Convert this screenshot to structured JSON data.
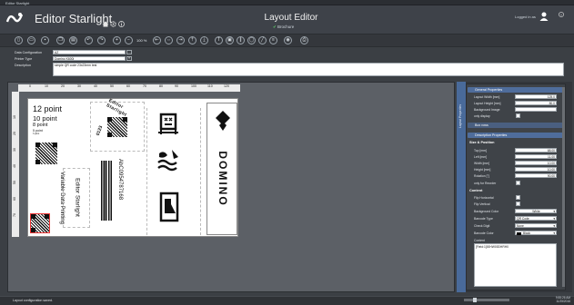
{
  "window": {
    "title": "Editor Starlight"
  },
  "header": {
    "app_name": "Editor Starlight",
    "layout_title": "Layout Editor",
    "layout_subtitle": "Brochure",
    "logged_in": "Logged in as"
  },
  "toolbar": {
    "zoom": "100 %"
  },
  "form": {
    "data_config_label": "Data Configuration",
    "data_config_value": "AZ",
    "printer_type_label": "Printer Type",
    "printer_type_value": "Domino K600i",
    "description_label": "Description",
    "description_value": "simple QR code 23x23mm test"
  },
  "ruler": {
    "top": [
      "0",
      "10",
      "20",
      "30",
      "40",
      "50",
      "60",
      "70",
      "80",
      "90",
      "100",
      "110",
      "120"
    ],
    "left": [
      "10",
      "20",
      "30",
      "40",
      "50",
      "60",
      "70"
    ]
  },
  "canvas": {
    "t12": "12 point",
    "t10": "10 point",
    "t8": "8 point",
    "t5": "5 point",
    "t3": "3 point",
    "arc_top": "Editor Starlight",
    "arc_bottom": "0123",
    "var_line1": "Editor Starlight",
    "var_line2": "Variable Data Printing",
    "barcode_text": "AbC0954787168",
    "brand": "DOMINO"
  },
  "panel": {
    "side_tab": "Layout Properties",
    "general_header": "General Properties",
    "layout_width_label": "Layout Width [mm]",
    "layout_width_value": "125.0",
    "layout_height_label": "Layout Height [mm]",
    "layout_height_value": "80.0",
    "bg_image_label": "Background Image",
    "only_display_label": "only display",
    "box_rows_header": "Box rows",
    "desc_header": "Description Properties",
    "size_pos_header": "Size & Position",
    "top_label": "Top [mm]",
    "top_value": "68.00",
    "left_label": "Left [mm]",
    "left_value": "11.00",
    "width_label": "Width [mm]",
    "width_value": "10.00",
    "height_label": "Height [mm]",
    "height_value": "10.00",
    "rotation_label": "Rotation [°]",
    "rotation_value": "90.00",
    "only_reorder_label": "only for Reorder",
    "content_header": "Content",
    "flip_h_label": "Flip Horizontal",
    "flip_v_label": "Flip Vertical",
    "bg_color_label": "Background Color",
    "bg_color_value": "White",
    "barcode_type_label": "Barcode Type",
    "barcode_type_value": "QR Code",
    "check_digit_label": "Check Digit",
    "check_digit_value": "None",
    "barcode_color_label": "Barcode Color",
    "barcode_color_value": "Black",
    "content_label": "Content",
    "content_value": "[Field:1]00HW00DHRH0"
  },
  "status": {
    "message": "Layout configuration saved.",
    "time": "9:55:26 AM",
    "date": "11/25/2016"
  },
  "colors": {
    "accent": "#4f6d9c",
    "header": "#3e4249",
    "teal": "#3f6f67"
  }
}
